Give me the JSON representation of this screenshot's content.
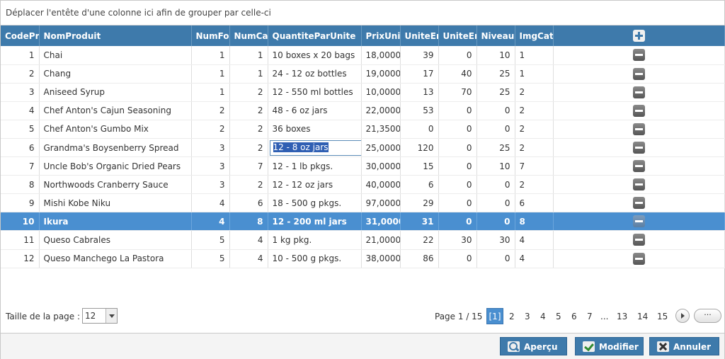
{
  "group_panel": {
    "text": "Déplacer l'entête d'une colonne ici afin de grouper par celle-ci"
  },
  "columns": [
    "CodePr",
    "NomProduit",
    "NumFo",
    "NumCat",
    "QuantiteParUnite",
    "PrixUni",
    "UniteEn",
    "UniteEn",
    "NiveauR",
    "ImgCate"
  ],
  "rows": [
    {
      "code": "1",
      "name": "Chai",
      "numfo": "1",
      "numcat": "1",
      "qty": "10 boxes x 20 bags",
      "prix": "18,0000",
      "stock": "39",
      "cmd": "0",
      "niveau": "10",
      "img": "1"
    },
    {
      "code": "2",
      "name": "Chang",
      "numfo": "1",
      "numcat": "1",
      "qty": "24 - 12 oz bottles",
      "prix": "19,0000",
      "stock": "17",
      "cmd": "40",
      "niveau": "25",
      "img": "1"
    },
    {
      "code": "3",
      "name": "Aniseed Syrup",
      "numfo": "1",
      "numcat": "2",
      "qty": "12 - 550 ml bottles",
      "prix": "10,0000",
      "stock": "13",
      "cmd": "70",
      "niveau": "25",
      "img": "2"
    },
    {
      "code": "4",
      "name": "Chef Anton's Cajun Seasoning",
      "numfo": "2",
      "numcat": "2",
      "qty": "48 - 6 oz jars",
      "prix": "22,0000",
      "stock": "53",
      "cmd": "0",
      "niveau": "0",
      "img": "2"
    },
    {
      "code": "5",
      "name": "Chef Anton's Gumbo Mix",
      "numfo": "2",
      "numcat": "2",
      "qty": "36 boxes",
      "prix": "21,3500",
      "stock": "0",
      "cmd": "0",
      "niveau": "0",
      "img": "2"
    },
    {
      "code": "6",
      "name": "Grandma's Boysenberry Spread",
      "numfo": "3",
      "numcat": "2",
      "qty": "12 - 8 oz jars",
      "prix": "25,0000",
      "stock": "120",
      "cmd": "0",
      "niveau": "25",
      "img": "2"
    },
    {
      "code": "7",
      "name": "Uncle Bob's Organic Dried Pears",
      "numfo": "3",
      "numcat": "7",
      "qty": "12 - 1 lb pkgs.",
      "prix": "30,0000",
      "stock": "15",
      "cmd": "0",
      "niveau": "10",
      "img": "7"
    },
    {
      "code": "8",
      "name": "Northwoods Cranberry Sauce",
      "numfo": "3",
      "numcat": "2",
      "qty": "12 - 12 oz jars",
      "prix": "40,0000",
      "stock": "6",
      "cmd": "0",
      "niveau": "0",
      "img": "2"
    },
    {
      "code": "9",
      "name": "Mishi Kobe Niku",
      "numfo": "4",
      "numcat": "6",
      "qty": "18 - 500 g pkgs.",
      "prix": "97,0000",
      "stock": "29",
      "cmd": "0",
      "niveau": "0",
      "img": "6"
    },
    {
      "code": "10",
      "name": "Ikura",
      "numfo": "4",
      "numcat": "8",
      "qty": "12 - 200 ml jars",
      "prix": "31,0000",
      "stock": "31",
      "cmd": "0",
      "niveau": "0",
      "img": "8"
    },
    {
      "code": "11",
      "name": "Queso Cabrales",
      "numfo": "5",
      "numcat": "4",
      "qty": "1 kg pkg.",
      "prix": "21,0000",
      "stock": "22",
      "cmd": "30",
      "niveau": "30",
      "img": "4"
    },
    {
      "code": "12",
      "name": "Queso Manchego La Pastora",
      "numfo": "5",
      "numcat": "4",
      "qty": "10 - 500 g pkgs.",
      "prix": "38,0000",
      "stock": "86",
      "cmd": "0",
      "niveau": "0",
      "img": "4"
    }
  ],
  "selected_row": "10",
  "editing_row": "6",
  "pager": {
    "page_size_label": "Taille de la page :",
    "page_size": "12",
    "page_info": "Page 1 / 15",
    "current": "[1]",
    "pages": [
      "2",
      "3",
      "4",
      "5",
      "6",
      "7",
      "...",
      "13",
      "14",
      "15"
    ],
    "more": "···"
  },
  "buttons": {
    "preview": "Aperçu",
    "modify": "Modifier",
    "cancel": "Annuler"
  },
  "colors": {
    "header": "#3e7aab",
    "selected": "#4a8fd0"
  }
}
